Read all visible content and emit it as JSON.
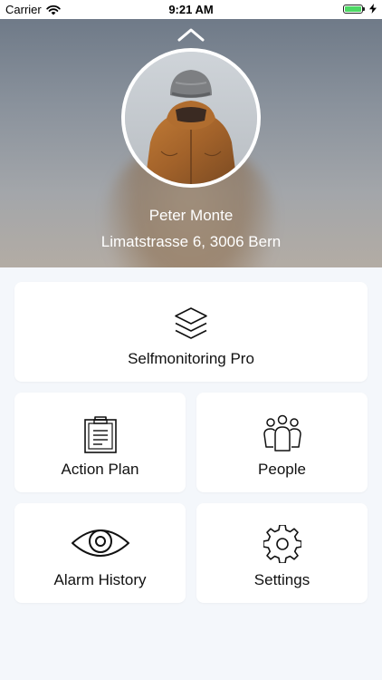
{
  "status_bar": {
    "carrier": "Carrier",
    "time": "9:21 AM",
    "battery_level": 1.0
  },
  "profile": {
    "name": "Peter Monte",
    "address": "Limatstrasse 6, 3006 Bern"
  },
  "menu": {
    "selfmonitoring": {
      "label": "Selfmonitoring Pro",
      "icon": "layers-icon"
    },
    "action_plan": {
      "label": "Action Plan",
      "icon": "clipboard-icon"
    },
    "people": {
      "label": "People",
      "icon": "people-icon"
    },
    "alarm_history": {
      "label": "Alarm History",
      "icon": "eye-icon"
    },
    "settings": {
      "label": "Settings",
      "icon": "gear-icon"
    }
  },
  "colors": {
    "background": "#f4f7fb",
    "tile": "#ffffff",
    "battery": "#4cd964"
  }
}
